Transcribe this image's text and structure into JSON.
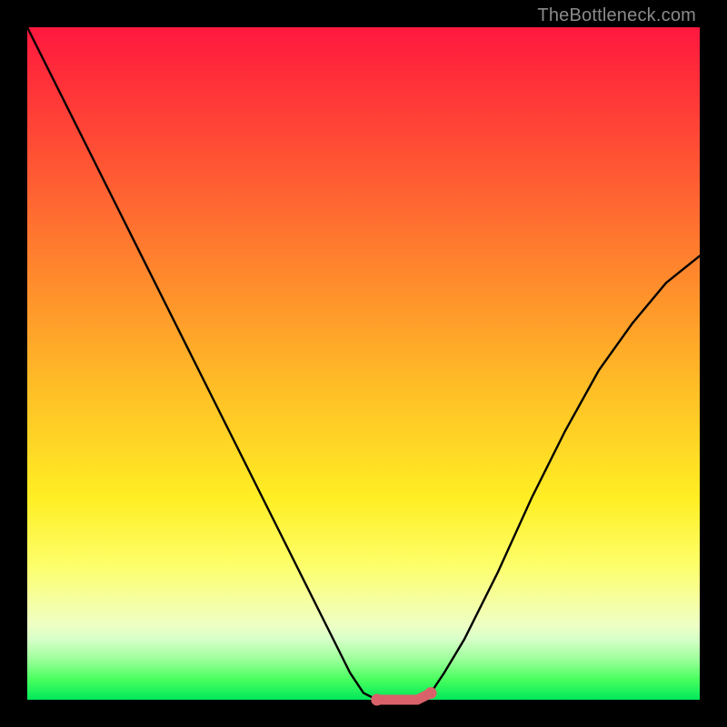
{
  "watermark": "TheBottleneck.com",
  "chart_data": {
    "type": "line",
    "title": "",
    "xlabel": "",
    "ylabel": "",
    "xlim": [
      0,
      100
    ],
    "ylim": [
      0,
      100
    ],
    "series": [
      {
        "name": "bottleneck-curve",
        "x": [
          0,
          2,
          5,
          8,
          12,
          16,
          20,
          25,
          30,
          35,
          40,
          45,
          48,
          50,
          52,
          55,
          58,
          60,
          62,
          65,
          70,
          75,
          80,
          85,
          90,
          95,
          100
        ],
        "values": [
          100,
          96,
          90,
          84,
          76,
          68,
          60,
          50,
          40,
          30,
          20,
          10,
          4,
          1,
          0,
          0,
          0,
          1,
          4,
          9,
          19,
          30,
          40,
          49,
          56,
          62,
          66
        ]
      },
      {
        "name": "highlight-segment",
        "x": [
          52,
          55,
          58,
          60
        ],
        "values": [
          0,
          0,
          0,
          1
        ]
      }
    ],
    "colors": {
      "curve": "#000000",
      "highlight": "#d9626a"
    }
  }
}
